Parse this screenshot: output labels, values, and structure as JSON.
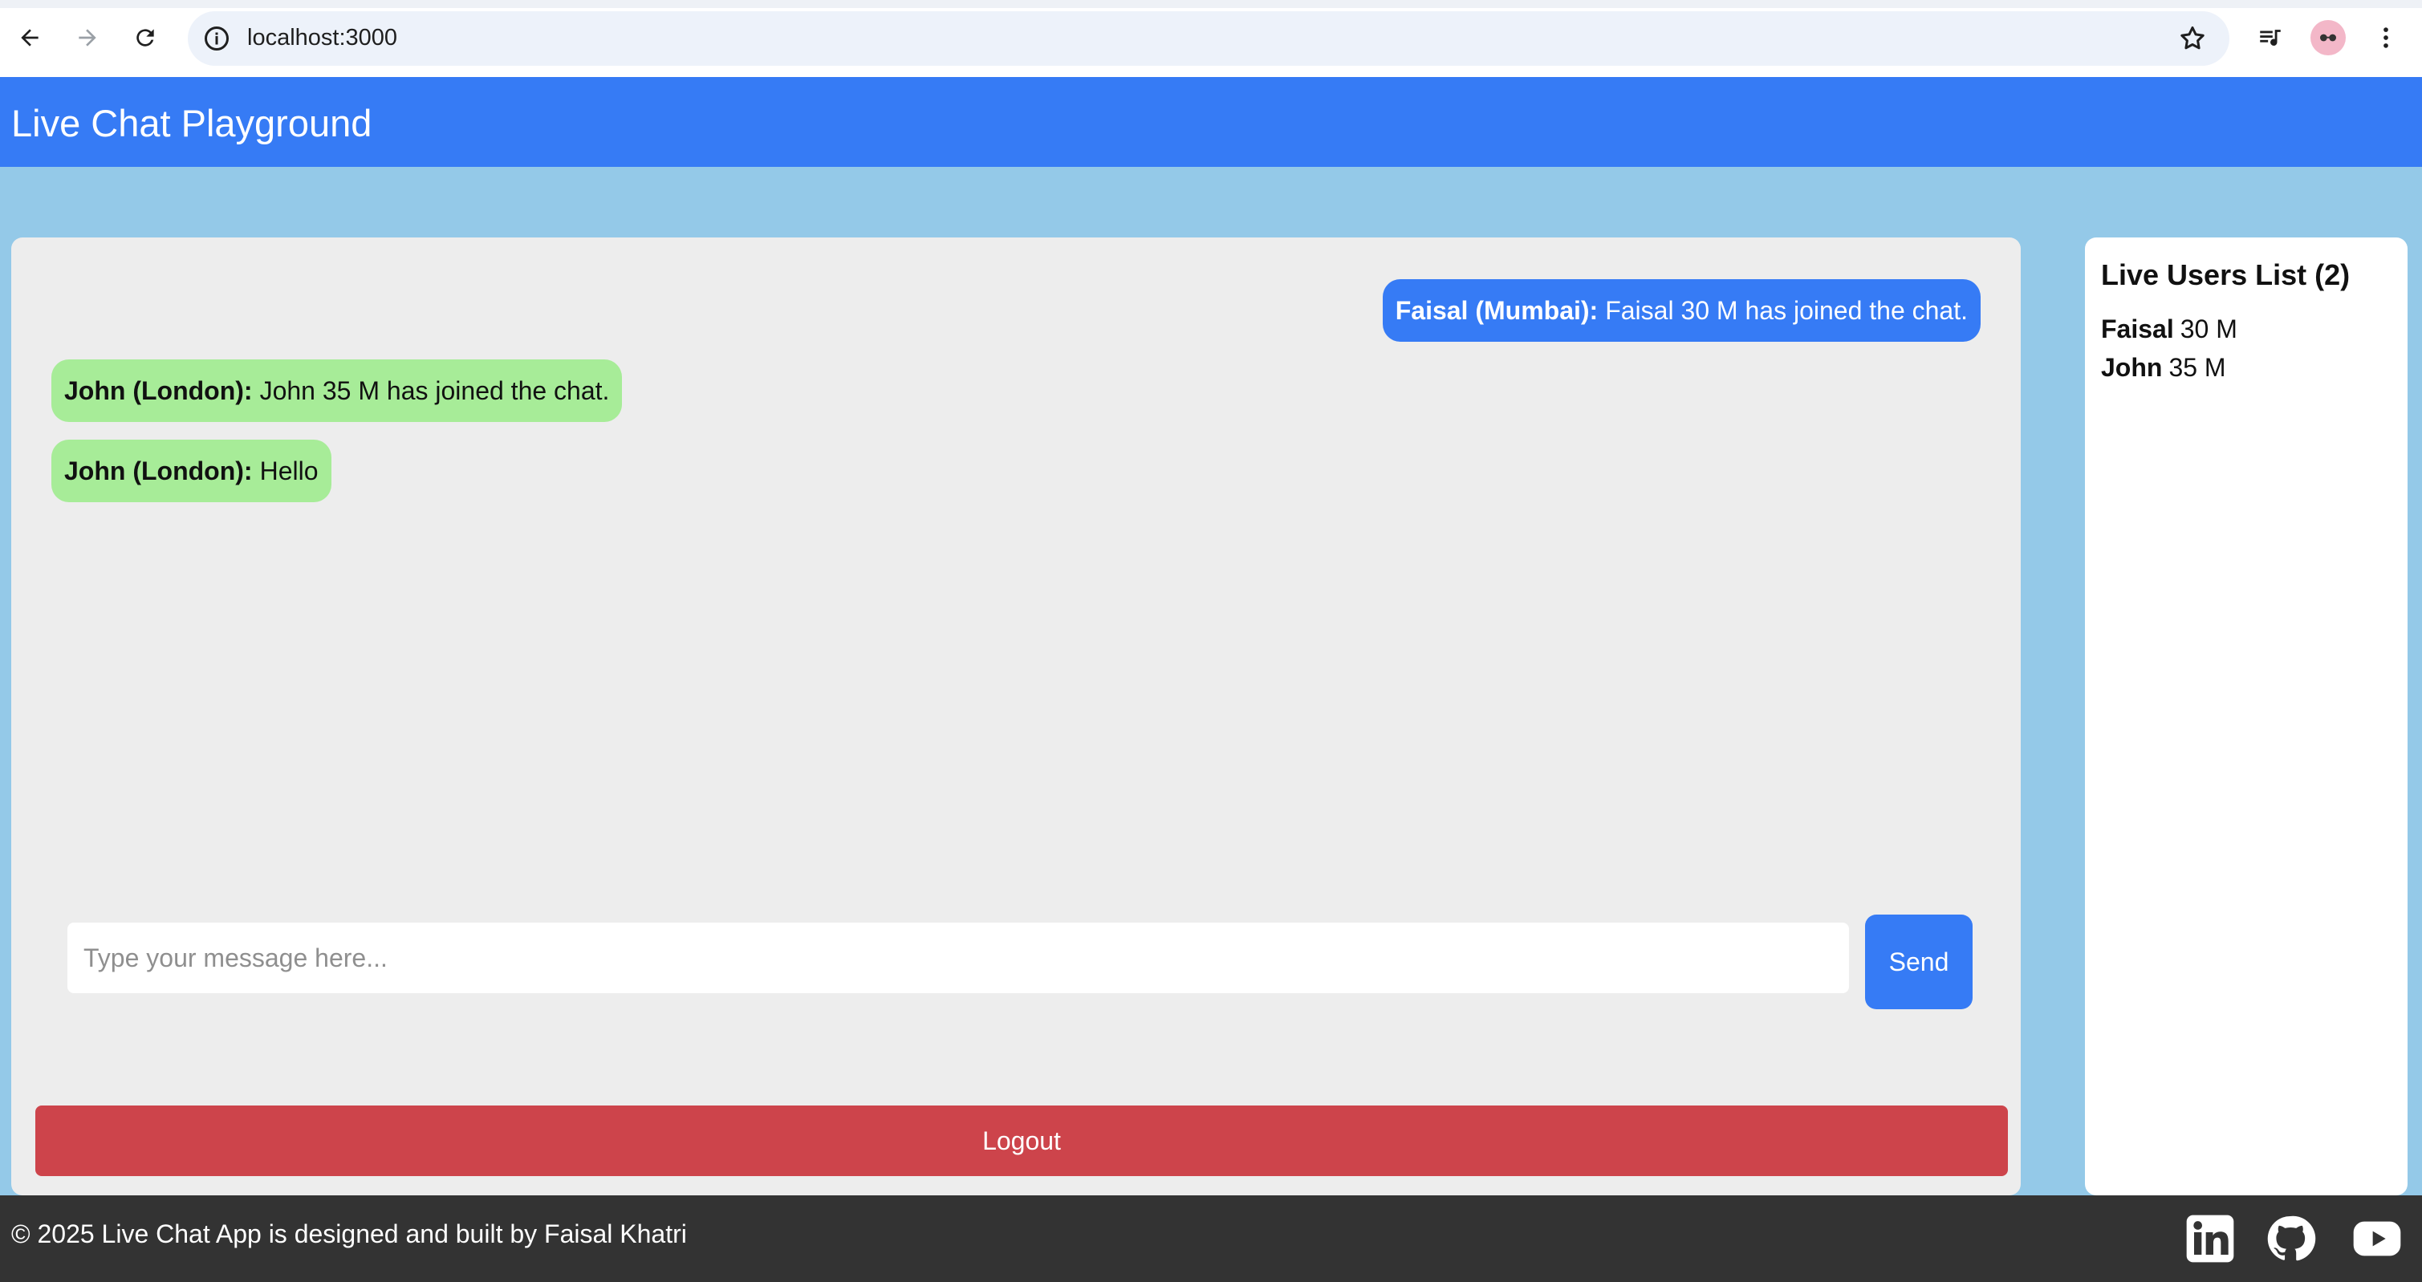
{
  "browser": {
    "url": "localhost:3000"
  },
  "app": {
    "title": "Live Chat Playground"
  },
  "chat": {
    "messages": [
      {
        "sender": "Faisal (Mumbai):",
        "text": "Faisal 30 M has joined the chat.",
        "mine": true
      },
      {
        "sender": "John (London):",
        "text": "John 35 M has joined the chat.",
        "mine": false
      },
      {
        "sender": "John (London):",
        "text": "Hello",
        "mine": false
      }
    ],
    "input_placeholder": "Type your message here...",
    "input_value": "",
    "send_label": "Send",
    "logout_label": "Logout"
  },
  "users": {
    "title": "Live Users List (2)",
    "list": [
      {
        "name": "Faisal",
        "info": "30 M"
      },
      {
        "name": "John",
        "info": "35 M"
      }
    ]
  },
  "footer": {
    "text": "© 2025 Live Chat App is designed and built by Faisal Khatri",
    "icons": [
      "linkedin-icon",
      "github-icon",
      "youtube-icon"
    ]
  },
  "colors": {
    "header": "#367bf5",
    "own_bubble": "#367bf5",
    "other_bubble": "#a7ec98",
    "logout": "#cd444b",
    "footer": "#333333",
    "page_bg": "#94c9e8"
  }
}
